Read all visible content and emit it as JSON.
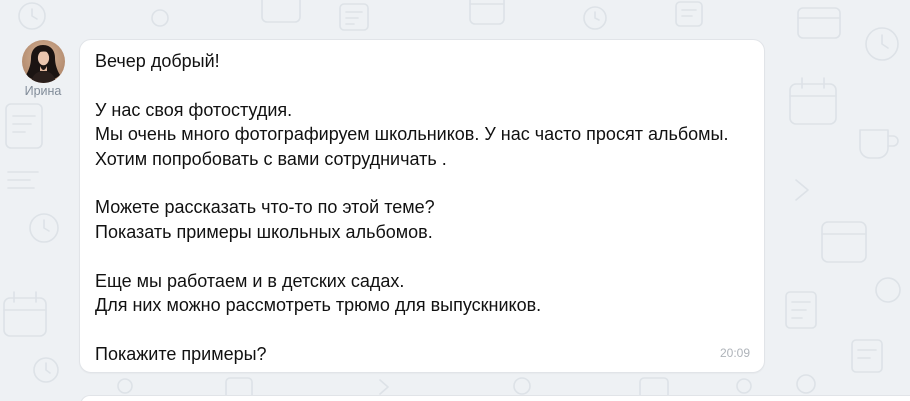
{
  "sender": {
    "name": "Ирина",
    "avatar_icon": "user-avatar-photo"
  },
  "message": {
    "paragraphs": [
      [
        "Вечер добрый!"
      ],
      [
        "У нас своя фотостудия.",
        "Мы очень много фотографируем школьников. У нас часто просят альбомы.",
        "Хотим попробовать с вами сотрудничать ."
      ],
      [
        "Можете рассказать что-то по этой теме?",
        "Показать примеры школьных альбомов."
      ],
      [
        "Еще мы работаем и в детских садах.",
        "Для них можно рассмотреть трюмо для выпускников."
      ],
      [
        "Покажите примеры?"
      ]
    ],
    "time": "20:09"
  },
  "icons": {
    "background_pattern": "doodle-pattern"
  },
  "colors": {
    "background": "#eef1f4",
    "bubble": "#ffffff",
    "text": "#111111",
    "sender_name": "#818c99",
    "timestamp": "#aeb3b9"
  }
}
